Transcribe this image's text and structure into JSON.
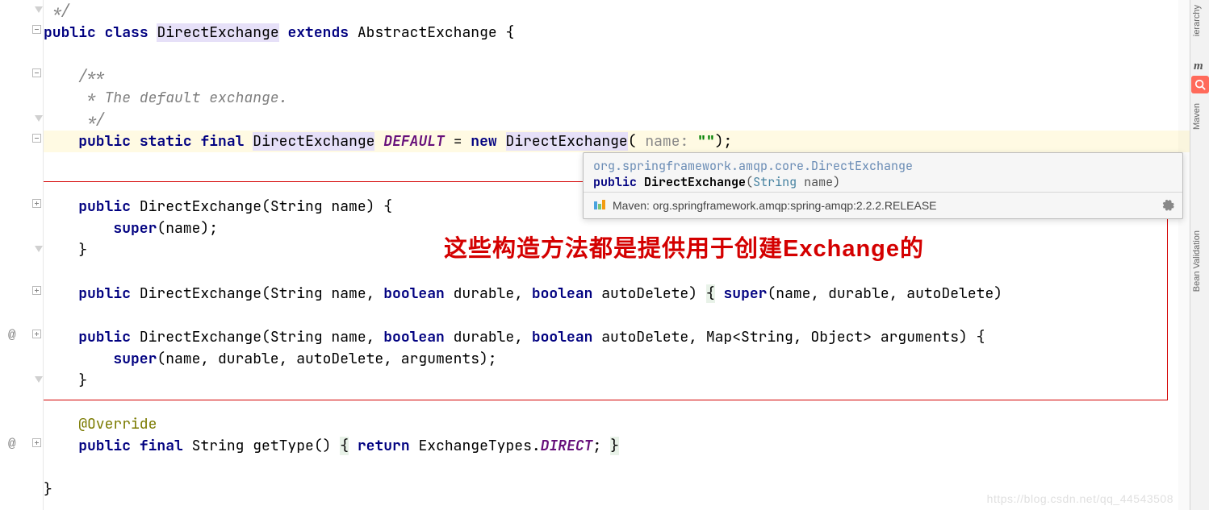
{
  "code": {
    "l1": " */",
    "l2_public": "public",
    "l2_class": "class",
    "l2_name": "DirectExchange",
    "l2_extends": "extends",
    "l2_parent": "AbstractExchange {",
    "l4": "/**",
    "l5": " * The default exchange.",
    "l6": " */",
    "l7_public": "public",
    "l7_static": "static",
    "l7_final": "final",
    "l7_type_a": "Dire",
    "l7_type_b": "ctExchange",
    "l7_field": "DEFAULT",
    "l7_eq": " = ",
    "l7_new": "new",
    "l7_ctor": "DirectExchange",
    "l7_hint": " name: ",
    "l7_str": "\"\"",
    "l7_tail": ");",
    "l9_public": "public",
    "l9_rest": " DirectExchange(String name) {",
    "l10_super": "super",
    "l10_rest": "(name);",
    "l11": "}",
    "l13_public": "public",
    "l13_a": " DirectExchange(String name, ",
    "l13_bool1": "boolean",
    "l13_b": " durable, ",
    "l13_bool2": "boolean",
    "l13_c": " autoDelete) ",
    "l13_super": "super",
    "l13_d": "(name, durable, autoDelete)",
    "l15_public": "public",
    "l15_a": " DirectExchange(String name, ",
    "l15_bool1": "boolean",
    "l15_b": " durable, ",
    "l15_bool2": "boolean",
    "l15_c": " autoDelete, Map<String, Object> arguments) {",
    "l16_super": "super",
    "l16_rest": "(name, durable, autoDelete, arguments);",
    "l17": "}",
    "l19_over": "@Override",
    "l20_public": "public",
    "l20_final": "final",
    "l20_a": " String getType() ",
    "l20_ret": "return",
    "l20_b": " ExchangeTypes.",
    "l20_fld": "DIRECT",
    "l20_c": "; ",
    "l22": "}"
  },
  "tooltip": {
    "fqcn": "org.springframework.amqp.core.DirectExchange",
    "sig_public": "public",
    "sig_cls": "DirectExchange",
    "sig_open": "(",
    "sig_type": "String",
    "sig_param": " name)",
    "maven_label": "Maven: org.springframework.amqp:spring-amqp:2.2.2.RELEASE"
  },
  "annotation": {
    "text": "这些构造方法都是提供用于创建Exchange的"
  },
  "sidebar": {
    "hierarchy": "ierarchy",
    "maven": "Maven",
    "m": "m",
    "bean_validation": "Bean Validation"
  },
  "watermark": "https://blog.csdn.net/qq_44543508"
}
